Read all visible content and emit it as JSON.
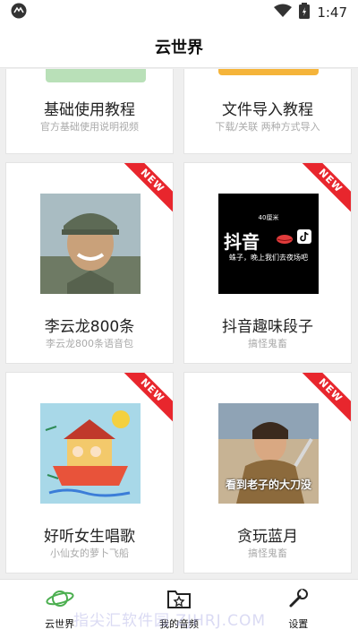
{
  "status_bar": {
    "time": "1:47",
    "icons": [
      "app-icon",
      "wifi-icon",
      "battery-icon"
    ]
  },
  "header": {
    "title": "云世界"
  },
  "cards": [
    {
      "title": "基础使用教程",
      "subtitle": "官方基础使用说明视频",
      "accent": "#b9e0b8",
      "new": false
    },
    {
      "title": "文件导入教程",
      "subtitle": "下载/关联 两种方式导入",
      "accent": "#f5b43a",
      "new": false
    },
    {
      "title": "李云龙800条",
      "subtitle": "李云龙800条语音包",
      "new": true,
      "new_label": "NEW"
    },
    {
      "title": "抖音趣味段子",
      "subtitle": "搞怪鬼畜",
      "new": true,
      "new_label": "NEW",
      "image_text_top": "40厘米",
      "image_text_main": "抖音",
      "image_text_bottom": "蛛子，晚上我们去夜场吧"
    },
    {
      "title": "好听女生唱歌",
      "subtitle": "小仙女的萝卜飞船",
      "new": true,
      "new_label": "NEW"
    },
    {
      "title": "贪玩蓝月",
      "subtitle": "搞怪鬼畜",
      "new": true,
      "new_label": "NEW",
      "image_caption": "看到老子的大刀没"
    }
  ],
  "bottom_nav": [
    {
      "label": "云世界",
      "icon": "planet-icon",
      "active": true
    },
    {
      "label": "我的音频",
      "icon": "star-folder-icon",
      "active": false
    },
    {
      "label": "设置",
      "icon": "wrench-icon",
      "active": false
    }
  ],
  "watermark": "指尖汇软件园 ZJHRJ.COM",
  "colors": {
    "accent_green": "#4caf50",
    "ribbon_red": "#e8262d"
  }
}
